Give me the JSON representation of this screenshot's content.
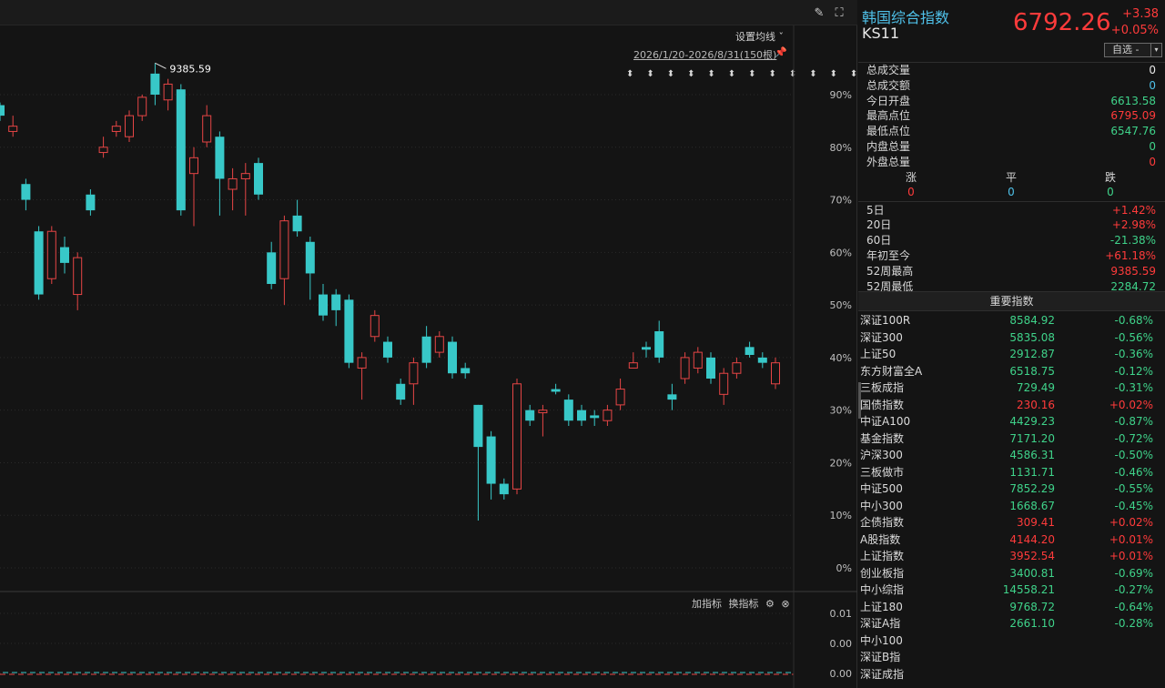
{
  "chart": {
    "ma_setting_label": "设置均线 ˇ",
    "date_range": "2026/1/20-2026/8/31(150根)",
    "high_marker_label": "9385.59",
    "arrows_text": "⬍ ⬍ ⬍ ⬍ ⬍ ⬍ ⬍ ⬍ ⬍ ⬍ ⬍ ⬍",
    "sub_add_indicator": "加指标",
    "sub_switch_indicator": "换指标",
    "colors": {
      "up": "#e64545",
      "down": "#38c8c8",
      "grid": "#2a2a2a"
    }
  },
  "chart_data": {
    "type": "candlestick",
    "y_axis_labels": [
      "90%",
      "80%",
      "70%",
      "60%",
      "50%",
      "40%",
      "30%",
      "20%",
      "10%",
      "0%"
    ],
    "sub_axis_labels": [
      "0.01",
      "0.00",
      "0.00"
    ],
    "annotations": [
      {
        "label": "9385.59",
        "meaning": "52-week high marker"
      }
    ],
    "candles": [
      {
        "d": "down",
        "o": 88,
        "c": 86,
        "h": 88.5,
        "l": 85
      },
      {
        "d": "up",
        "o": 83,
        "c": 84,
        "h": 86,
        "l": 82
      },
      {
        "d": "down",
        "o": 73,
        "c": 70,
        "h": 74,
        "l": 68
      },
      {
        "d": "down",
        "o": 64,
        "c": 52,
        "h": 65,
        "l": 51
      },
      {
        "d": "up",
        "o": 55,
        "c": 64,
        "h": 65,
        "l": 54
      },
      {
        "d": "down",
        "o": 61,
        "c": 58,
        "h": 63,
        "l": 56
      },
      {
        "d": "up",
        "o": 52,
        "c": 59,
        "h": 60,
        "l": 49
      },
      {
        "d": "down",
        "o": 71,
        "c": 68,
        "h": 72,
        "l": 67
      },
      {
        "d": "up",
        "o": 79,
        "c": 80,
        "h": 82,
        "l": 78
      },
      {
        "d": "up",
        "o": 83,
        "c": 84,
        "h": 85,
        "l": 82
      },
      {
        "d": "up",
        "o": 82,
        "c": 86,
        "h": 87,
        "l": 81
      },
      {
        "d": "up",
        "o": 86,
        "c": 89.5,
        "h": 90,
        "l": 85
      },
      {
        "d": "down",
        "o": 94,
        "c": 90,
        "h": 96,
        "l": 88
      },
      {
        "d": "up",
        "o": 89,
        "c": 92,
        "h": 93,
        "l": 87
      },
      {
        "d": "down",
        "o": 91,
        "c": 68,
        "h": 92,
        "l": 67
      },
      {
        "d": "up",
        "o": 75,
        "c": 78,
        "h": 80,
        "l": 65
      },
      {
        "d": "up",
        "o": 81,
        "c": 86,
        "h": 88,
        "l": 80
      },
      {
        "d": "down",
        "o": 82,
        "c": 74,
        "h": 83,
        "l": 67
      },
      {
        "d": "up",
        "o": 72,
        "c": 74,
        "h": 76,
        "l": 68
      },
      {
        "d": "up",
        "o": 74,
        "c": 75,
        "h": 77,
        "l": 67
      },
      {
        "d": "down",
        "o": 77,
        "c": 71,
        "h": 78,
        "l": 70
      },
      {
        "d": "down",
        "o": 60,
        "c": 54,
        "h": 62,
        "l": 53
      },
      {
        "d": "up",
        "o": 55,
        "c": 66,
        "h": 67,
        "l": 50
      },
      {
        "d": "down",
        "o": 67,
        "c": 64,
        "h": 70,
        "l": 63
      },
      {
        "d": "down",
        "o": 62,
        "c": 56,
        "h": 63,
        "l": 51
      },
      {
        "d": "down",
        "o": 52,
        "c": 48,
        "h": 54,
        "l": 47
      },
      {
        "d": "down",
        "o": 52,
        "c": 49,
        "h": 53,
        "l": 46
      },
      {
        "d": "down",
        "o": 51,
        "c": 39,
        "h": 52,
        "l": 38
      },
      {
        "d": "up",
        "o": 38,
        "c": 40,
        "h": 41,
        "l": 32
      },
      {
        "d": "up",
        "o": 44,
        "c": 48,
        "h": 49,
        "l": 43
      },
      {
        "d": "down",
        "o": 43,
        "c": 40,
        "h": 44,
        "l": 39
      },
      {
        "d": "down",
        "o": 35,
        "c": 32,
        "h": 36,
        "l": 31
      },
      {
        "d": "up",
        "o": 35,
        "c": 39,
        "h": 40,
        "l": 31
      },
      {
        "d": "down",
        "o": 44,
        "c": 39,
        "h": 46,
        "l": 38
      },
      {
        "d": "up",
        "o": 41,
        "c": 44,
        "h": 45,
        "l": 40
      },
      {
        "d": "down",
        "o": 43,
        "c": 37,
        "h": 44,
        "l": 36
      },
      {
        "d": "down",
        "o": 38,
        "c": 37,
        "h": 39,
        "l": 36
      },
      {
        "d": "down",
        "o": 31,
        "c": 23,
        "h": 31,
        "l": 9
      },
      {
        "d": "down",
        "o": 25,
        "c": 16,
        "h": 26,
        "l": 13
      },
      {
        "d": "down",
        "o": 16,
        "c": 14,
        "h": 17,
        "l": 13
      },
      {
        "d": "up",
        "o": 15,
        "c": 35,
        "h": 36,
        "l": 14
      },
      {
        "d": "down",
        "o": 30,
        "c": 28,
        "h": 31,
        "l": 27
      },
      {
        "d": "up",
        "o": 30,
        "c": 29.5,
        "h": 31,
        "l": 25
      },
      {
        "d": "down",
        "o": 34,
        "c": 33.5,
        "h": 35,
        "l": 33
      },
      {
        "d": "down",
        "o": 32,
        "c": 28,
        "h": 33,
        "l": 27
      },
      {
        "d": "down",
        "o": 30,
        "c": 28,
        "h": 31,
        "l": 27
      },
      {
        "d": "down",
        "o": 29,
        "c": 28.5,
        "h": 30,
        "l": 27
      },
      {
        "d": "up",
        "o": 28,
        "c": 30,
        "h": 31,
        "l": 27
      },
      {
        "d": "up",
        "o": 31,
        "c": 34,
        "h": 36,
        "l": 30
      },
      {
        "d": "up",
        "o": 38,
        "c": 39,
        "h": 41,
        "l": 38
      },
      {
        "d": "down",
        "o": 42,
        "c": 41.5,
        "h": 43,
        "l": 40
      },
      {
        "d": "down",
        "o": 45,
        "c": 40,
        "h": 47,
        "l": 39
      },
      {
        "d": "down",
        "o": 33,
        "c": 32,
        "h": 35,
        "l": 30
      },
      {
        "d": "up",
        "o": 36,
        "c": 40,
        "h": 41,
        "l": 35
      },
      {
        "d": "up",
        "o": 38,
        "c": 41,
        "h": 42,
        "l": 37
      },
      {
        "d": "down",
        "o": 40,
        "c": 36,
        "h": 41,
        "l": 35
      },
      {
        "d": "up",
        "o": 33,
        "c": 37,
        "h": 38,
        "l": 31
      },
      {
        "d": "up",
        "o": 37,
        "c": 39,
        "h": 40,
        "l": 36
      },
      {
        "d": "down",
        "o": 42,
        "c": 40.5,
        "h": 43,
        "l": 40
      },
      {
        "d": "down",
        "o": 40,
        "c": 39,
        "h": 41,
        "l": 38
      },
      {
        "d": "up",
        "o": 35,
        "c": 39,
        "h": 40,
        "l": 34
      }
    ]
  },
  "header": {
    "name": "韩国综合指数",
    "code": "KS11",
    "price": "6792.26",
    "change": "+3.38",
    "change_pct": "+0.05%",
    "watch_label": "自选 -",
    "watch_arrow": "▾"
  },
  "stats": [
    {
      "label": "总成交量",
      "value": "0",
      "color": "#e8e8e8"
    },
    {
      "label": "总成交额",
      "value": "0",
      "color": "#4fc1e9"
    },
    {
      "label": "今日开盘",
      "value": "6613.58",
      "color": "#3fd38a"
    },
    {
      "label": "最高点位",
      "value": "6795.09",
      "color": "#ff3b3b"
    },
    {
      "label": "最低点位",
      "value": "6547.76",
      "color": "#3fd38a"
    },
    {
      "label": "内盘总量",
      "value": "0",
      "color": "#3fd38a"
    },
    {
      "label": "外盘总量",
      "value": "0",
      "color": "#ff3b3b"
    }
  ],
  "updown": {
    "rise_label": "涨",
    "rise_value": "0",
    "flat_label": "平",
    "flat_value": "0",
    "fall_label": "跌",
    "fall_value": "0"
  },
  "periods": [
    {
      "label": "5日",
      "value": "+1.42%",
      "color": "#ff3b3b"
    },
    {
      "label": "20日",
      "value": "+2.98%",
      "color": "#ff3b3b"
    },
    {
      "label": "60日",
      "value": "-21.38%",
      "color": "#3fd38a"
    },
    {
      "label": "年初至今",
      "value": "+61.18%",
      "color": "#ff3b3b"
    },
    {
      "label": "52周最高",
      "value": "9385.59",
      "color": "#ff3b3b"
    },
    {
      "label": "52周最低",
      "value": "2284.72",
      "color": "#3fd38a"
    }
  ],
  "major_header": "重要指数",
  "major_indices": [
    {
      "name": "深证100R",
      "value": "8584.92",
      "pct": "-0.68%",
      "dir": "down"
    },
    {
      "name": "深证300",
      "value": "5835.08",
      "pct": "-0.56%",
      "dir": "down"
    },
    {
      "name": "上证50",
      "value": "2912.87",
      "pct": "-0.36%",
      "dir": "down"
    },
    {
      "name": "东方财富全A",
      "value": "6518.75",
      "pct": "-0.12%",
      "dir": "down"
    },
    {
      "name": "三板成指",
      "value": "729.49",
      "pct": "-0.31%",
      "dir": "down"
    },
    {
      "name": "国债指数",
      "value": "230.16",
      "pct": "+0.02%",
      "dir": "up"
    },
    {
      "name": "中证A100",
      "value": "4429.23",
      "pct": "-0.87%",
      "dir": "down"
    },
    {
      "name": "基金指数",
      "value": "7171.20",
      "pct": "-0.72%",
      "dir": "down"
    },
    {
      "name": "沪深300",
      "value": "4586.31",
      "pct": "-0.50%",
      "dir": "down"
    },
    {
      "name": "三板做市",
      "value": "1131.71",
      "pct": "-0.46%",
      "dir": "down"
    },
    {
      "name": "中证500",
      "value": "7852.29",
      "pct": "-0.55%",
      "dir": "down"
    },
    {
      "name": "中小300",
      "value": "1668.67",
      "pct": "-0.45%",
      "dir": "down"
    },
    {
      "name": "企债指数",
      "value": "309.41",
      "pct": "+0.02%",
      "dir": "up"
    },
    {
      "name": "A股指数",
      "value": "4144.20",
      "pct": "+0.01%",
      "dir": "up"
    },
    {
      "name": "上证指数",
      "value": "3952.54",
      "pct": "+0.01%",
      "dir": "up"
    },
    {
      "name": "创业板指",
      "value": "3400.81",
      "pct": "-0.69%",
      "dir": "down"
    },
    {
      "name": "中小综指",
      "value": "14558.21",
      "pct": "-0.27%",
      "dir": "down"
    },
    {
      "name": "上证180",
      "value": "9768.72",
      "pct": "-0.64%",
      "dir": "down"
    },
    {
      "name": "深证A指",
      "value": "2661.10",
      "pct": "-0.28%",
      "dir": "down"
    },
    {
      "name": "中小100",
      "value": "",
      "pct": "",
      "dir": "down"
    },
    {
      "name": "深证B指",
      "value": "",
      "pct": "",
      "dir": "down"
    },
    {
      "name": "深证成指",
      "value": "",
      "pct": "",
      "dir": "down"
    }
  ]
}
